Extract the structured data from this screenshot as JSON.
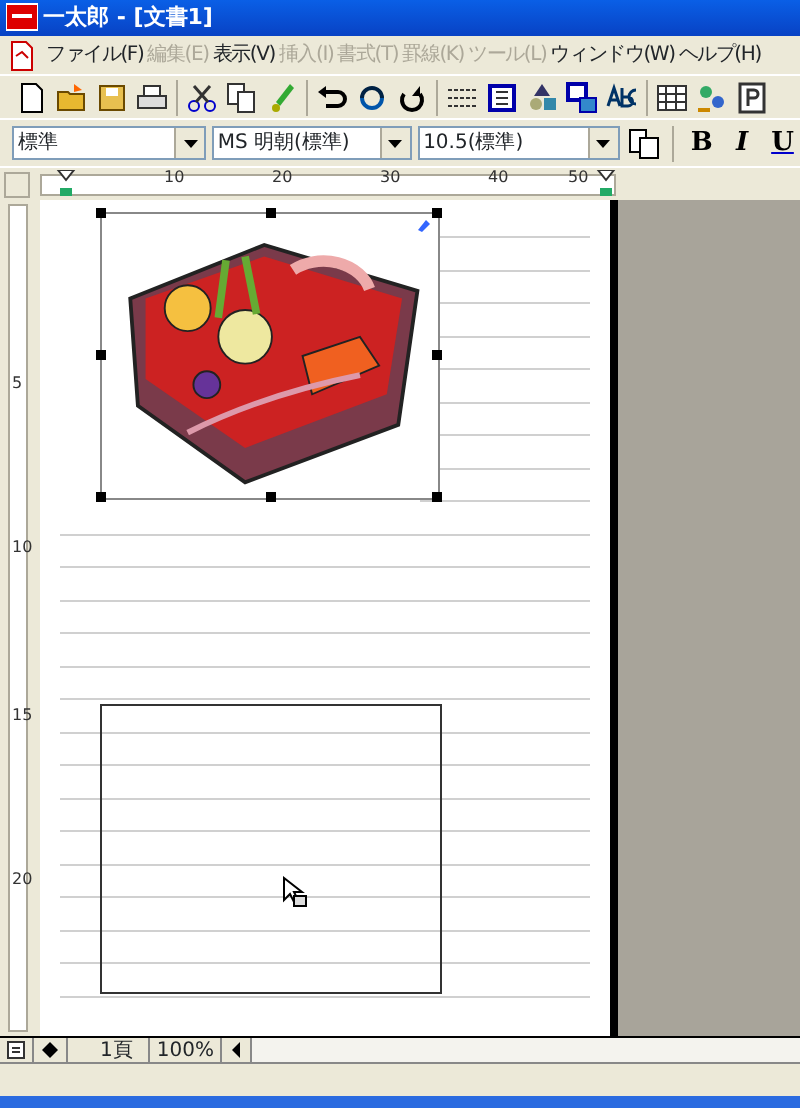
{
  "window": {
    "title": "一太郎 - [文書1]"
  },
  "menu": [
    {
      "label": "ファイル(F)",
      "disabled": false
    },
    {
      "label": "編集(E)",
      "disabled": true
    },
    {
      "label": "表示(V)",
      "disabled": false
    },
    {
      "label": "挿入(I)",
      "disabled": true
    },
    {
      "label": "書式(T)",
      "disabled": true
    },
    {
      "label": "罫線(K)",
      "disabled": true
    },
    {
      "label": "ツール(L)",
      "disabled": true
    },
    {
      "label": "ウィンドウ(W)",
      "disabled": false
    },
    {
      "label": "ヘルプ(H)",
      "disabled": false
    }
  ],
  "format_bar": {
    "style": "標準",
    "font": "MS 明朝(標準)",
    "size": "10.5(標準)",
    "buttons": [
      {
        "label": "B",
        "kind": "bold"
      },
      {
        "label": "I",
        "kind": "italic"
      },
      {
        "label": "U",
        "kind": "underline"
      }
    ]
  },
  "ruler": {
    "horizontal_labels": [
      "10",
      "20",
      "30",
      "40",
      "50"
    ],
    "vertical_labels": [
      "5",
      "10",
      "15",
      "20"
    ]
  },
  "document": {
    "image_selected": true
  },
  "status_bar": {
    "page": "1頁",
    "zoom": "100%"
  }
}
